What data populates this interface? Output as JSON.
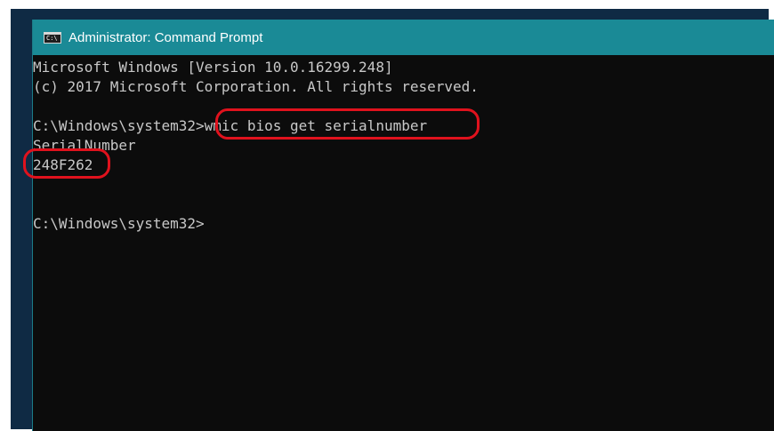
{
  "window": {
    "title": "Administrator: Command Prompt",
    "icon": "cmd-console-icon",
    "icon_glyph": "C:\\"
  },
  "colors": {
    "title_bar": "#1a8a96",
    "console_bg": "#0c0c0c",
    "console_text": "#c8c8c8",
    "highlight": "#e0121d"
  },
  "console": {
    "line_1": "Microsoft Windows [Version 10.0.16299.248]",
    "line_2": "(c) 2017 Microsoft Corporation. All rights reserved.",
    "line_3": "",
    "prompt_1": "C:\\Windows\\system32>",
    "command_1": "wmic bios get serialnumber",
    "output_header": "SerialNumber",
    "output_value": "248F262",
    "line_7": "",
    "line_8": "",
    "prompt_2": "C:\\Windows\\system32>"
  }
}
